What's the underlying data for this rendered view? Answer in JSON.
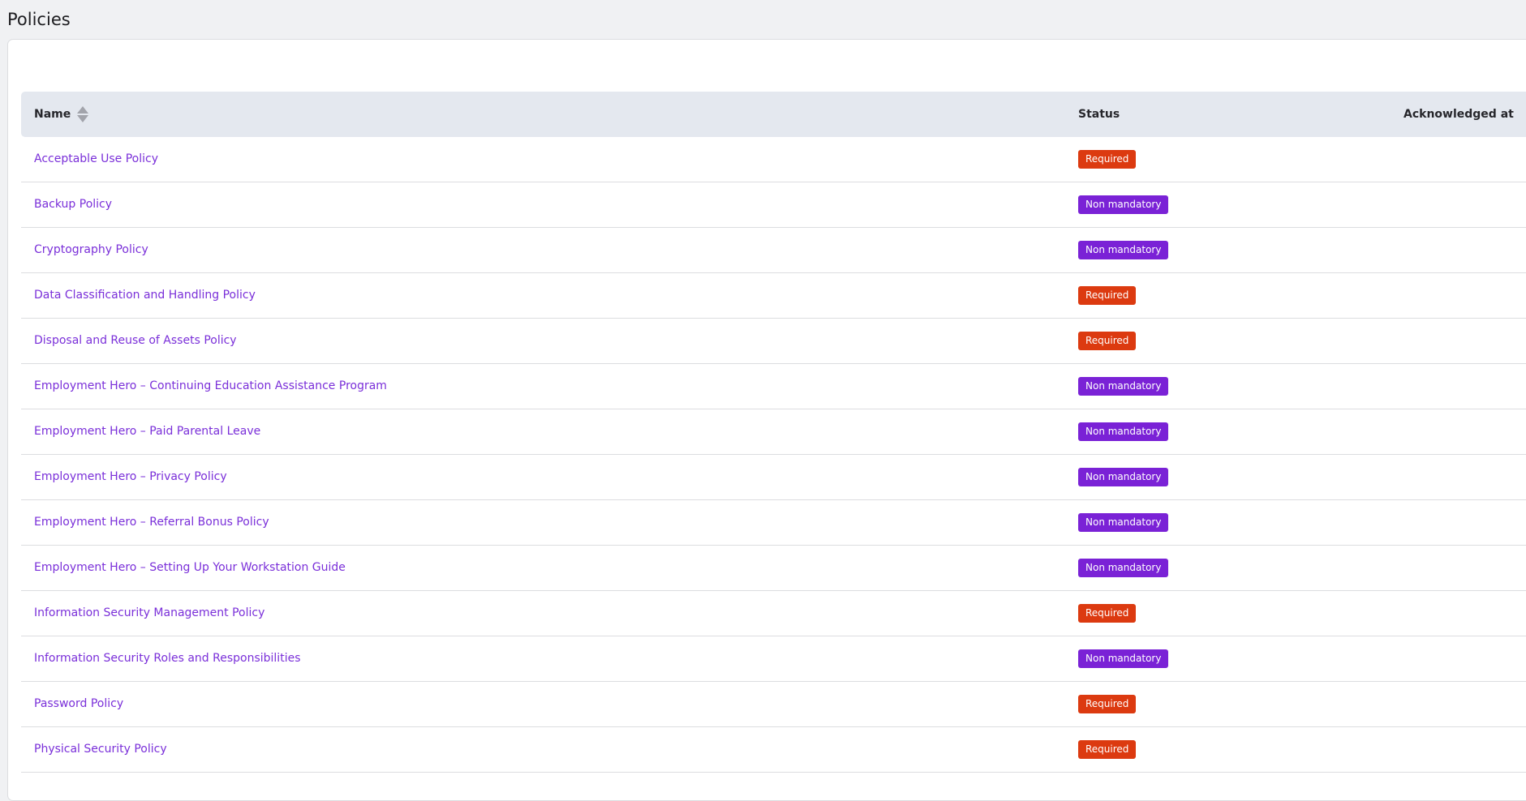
{
  "page": {
    "title": "Policies"
  },
  "table": {
    "columns": {
      "name": "Name",
      "status": "Status",
      "acknowledged_at": "Acknowledged at"
    },
    "sort": {
      "column": "name",
      "icon": "sort-icon"
    },
    "status_colors": {
      "Required": "#dc3a10",
      "Non mandatory": "#7a22d6"
    },
    "rows": [
      {
        "name": "Acceptable Use Policy",
        "status": "Required",
        "acknowledged_at": ""
      },
      {
        "name": "Backup Policy",
        "status": "Non mandatory",
        "acknowledged_at": ""
      },
      {
        "name": "Cryptography Policy",
        "status": "Non mandatory",
        "acknowledged_at": ""
      },
      {
        "name": "Data Classification and Handling Policy",
        "status": "Required",
        "acknowledged_at": ""
      },
      {
        "name": "Disposal and Reuse of Assets Policy",
        "status": "Required",
        "acknowledged_at": ""
      },
      {
        "name": "Employment Hero – Continuing Education Assistance Program",
        "status": "Non mandatory",
        "acknowledged_at": ""
      },
      {
        "name": "Employment Hero – Paid Parental Leave",
        "status": "Non mandatory",
        "acknowledged_at": ""
      },
      {
        "name": "Employment Hero – Privacy Policy",
        "status": "Non mandatory",
        "acknowledged_at": ""
      },
      {
        "name": "Employment Hero – Referral Bonus Policy",
        "status": "Non mandatory",
        "acknowledged_at": ""
      },
      {
        "name": "Employment Hero – Setting Up Your Workstation Guide",
        "status": "Non mandatory",
        "acknowledged_at": ""
      },
      {
        "name": "Information Security Management Policy",
        "status": "Required",
        "acknowledged_at": ""
      },
      {
        "name": "Information Security Roles and Responsibilities",
        "status": "Non mandatory",
        "acknowledged_at": ""
      },
      {
        "name": "Password Policy",
        "status": "Required",
        "acknowledged_at": ""
      },
      {
        "name": "Physical Security Policy",
        "status": "Required",
        "acknowledged_at": ""
      }
    ]
  }
}
